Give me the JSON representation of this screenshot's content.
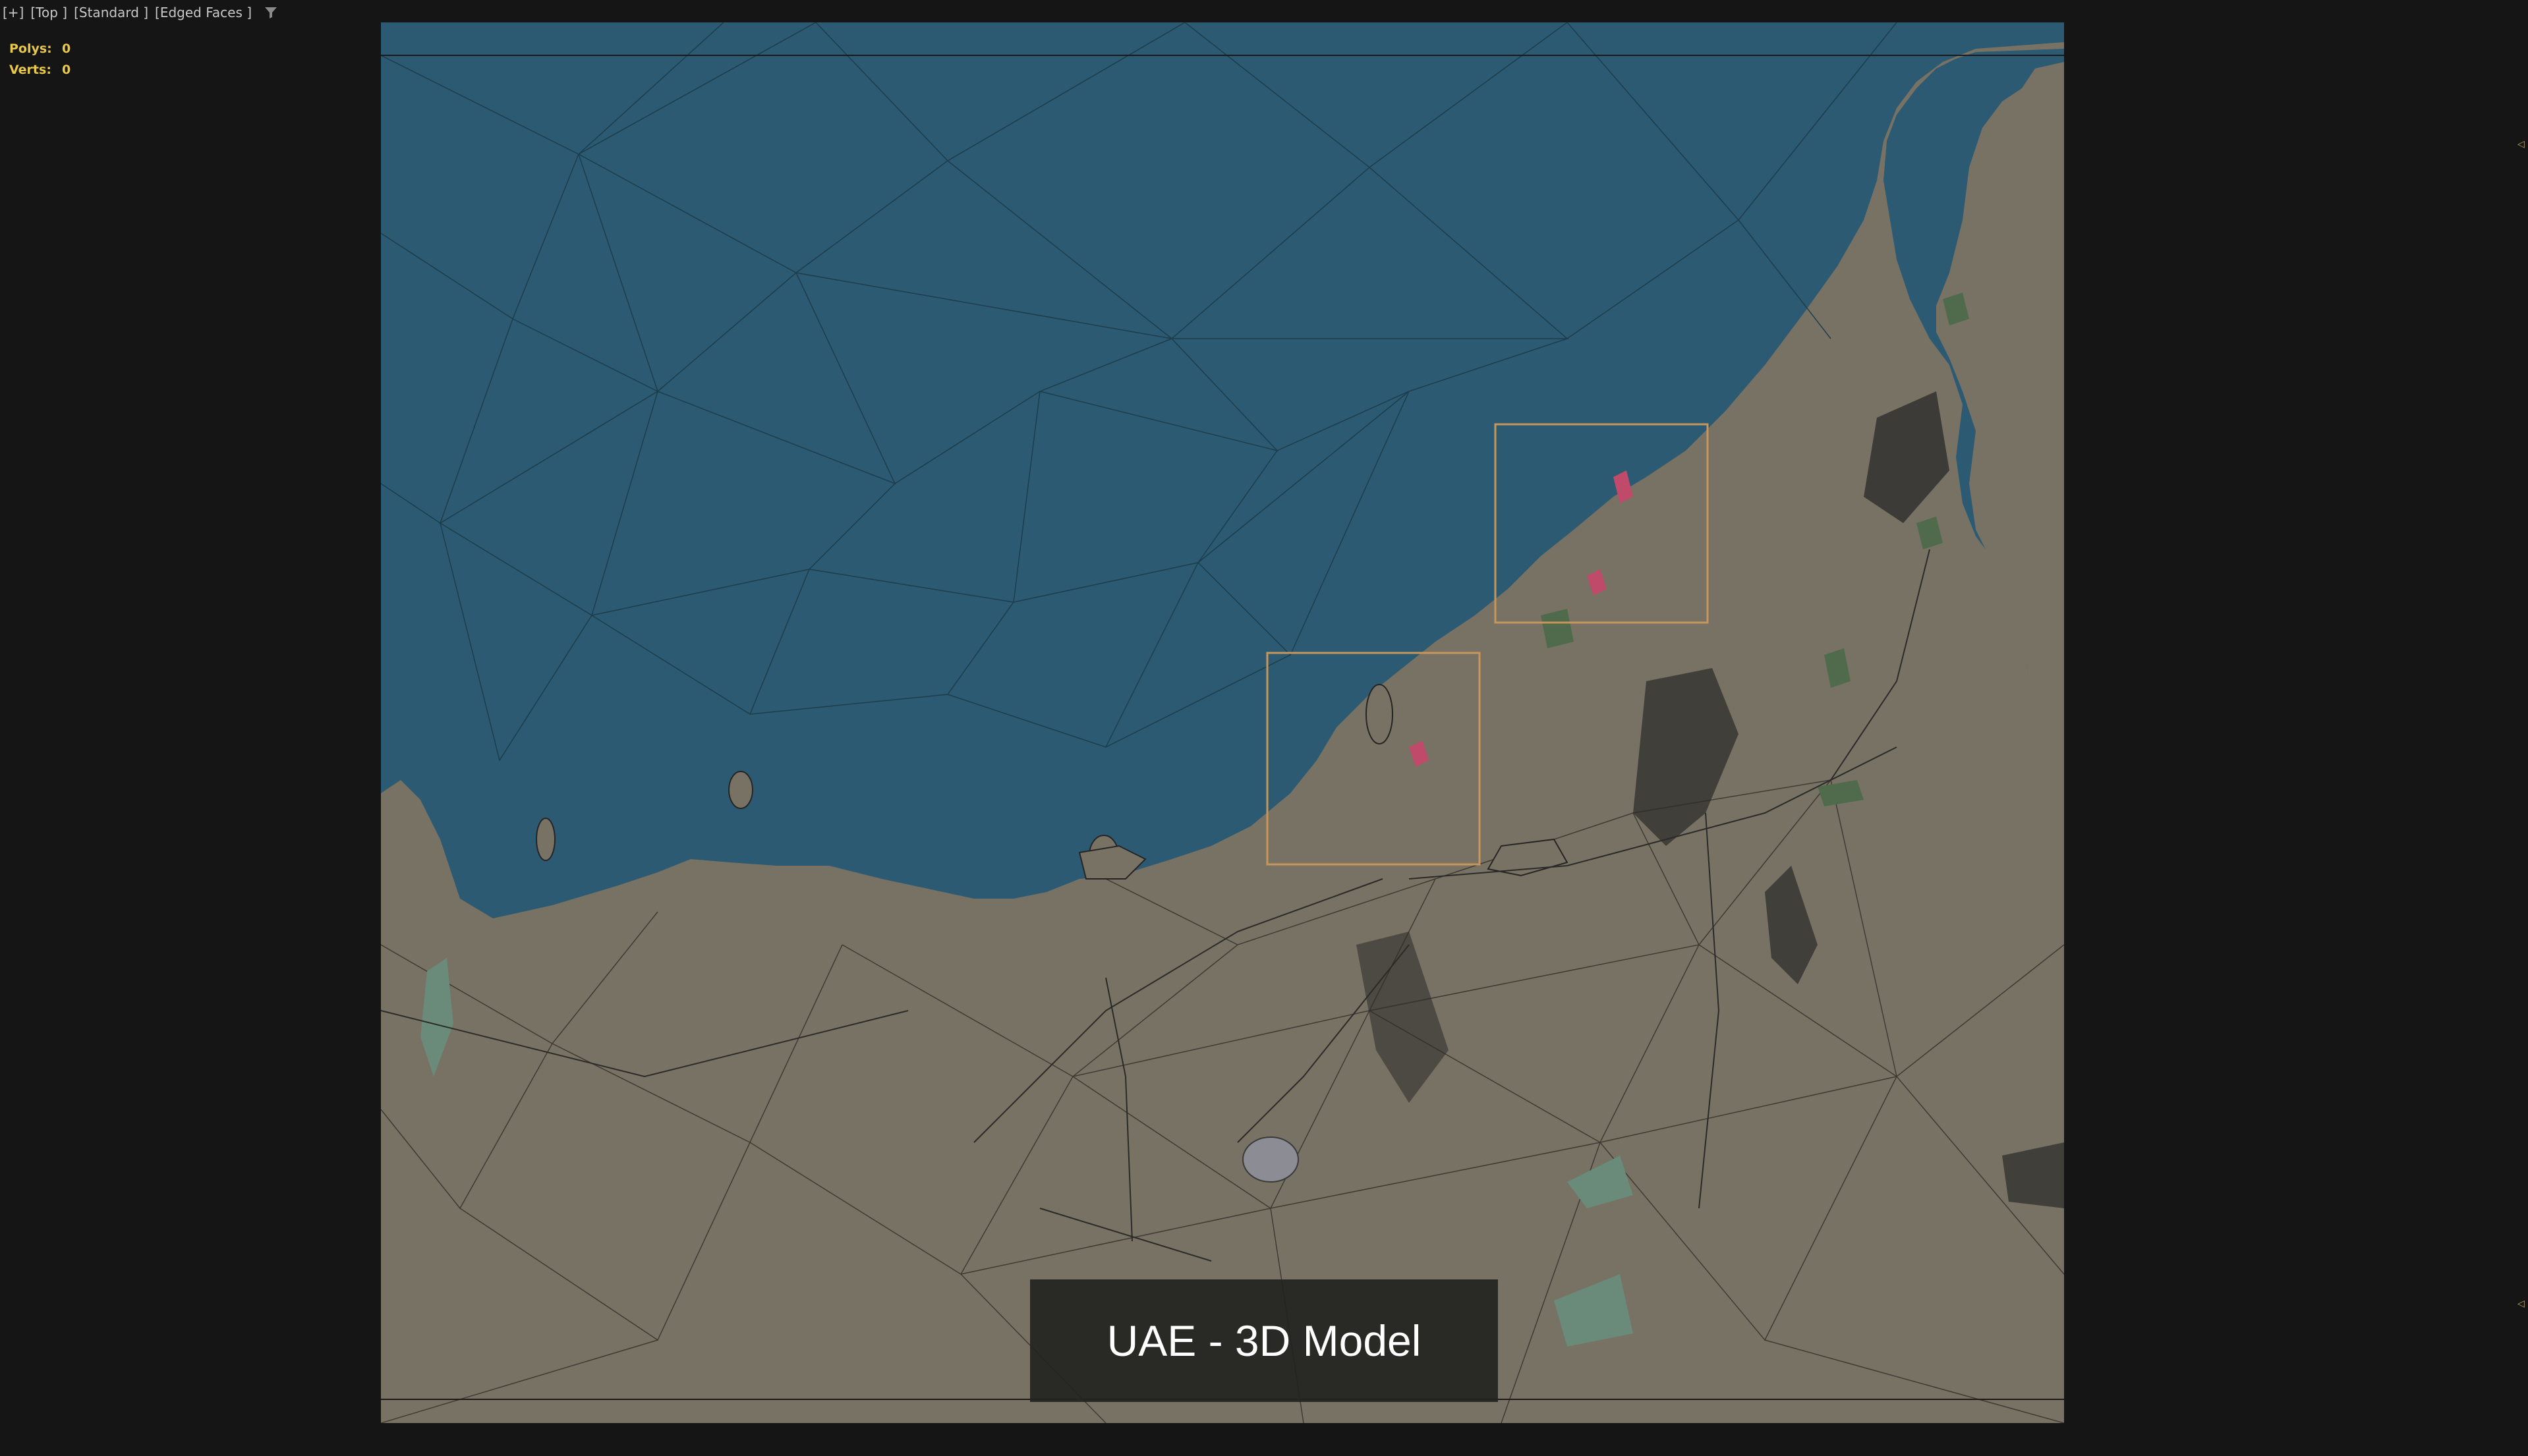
{
  "viewport": {
    "menu_plus": "[+]",
    "menu_view": "[Top ]",
    "menu_shading": "[Standard ]",
    "menu_edges": "[Edged Faces ]",
    "filter_icon": "funnel-icon"
  },
  "stats": {
    "polys_label": "Polys:",
    "polys_value": "0",
    "verts_label": "Verts:",
    "verts_value": "0",
    "color": "#e8c84a"
  },
  "map": {
    "sea_color": "#2b5a72",
    "land_color": "#787264",
    "selection_color": "#c8965a"
  },
  "caption": {
    "text": "UAE - 3D Model"
  }
}
